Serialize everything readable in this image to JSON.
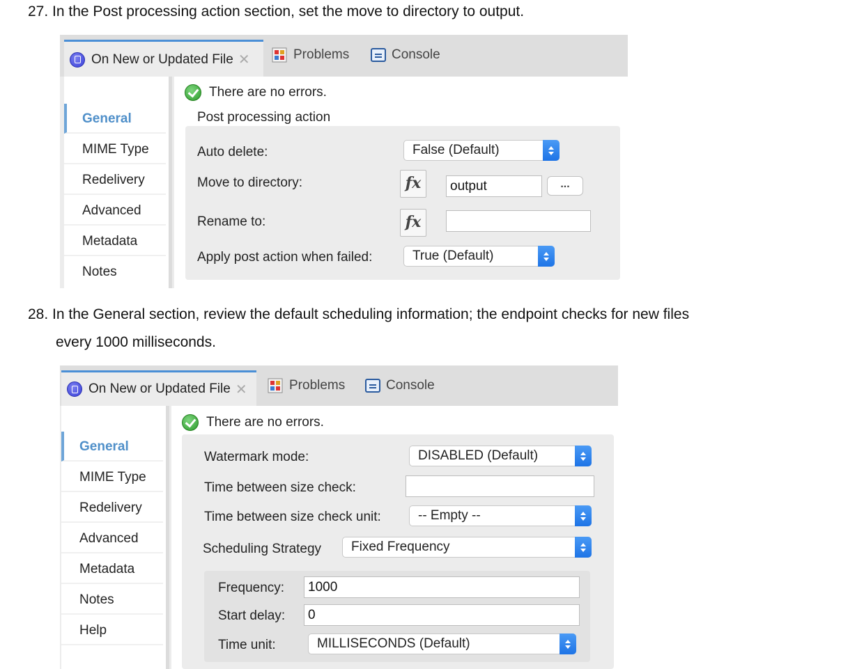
{
  "steps": [
    {
      "number": "27.",
      "text": "In the Post processing action section, set the move to directory to output."
    },
    {
      "number": "28.",
      "text_line1": "In the General section, review the default scheduling information; the endpoint checks for new files",
      "text_line2": "every 1000 milliseconds."
    }
  ],
  "tabs": {
    "active": "On New or Updated File",
    "problems": "Problems",
    "console": "Console"
  },
  "status": "There are no errors.",
  "sidebar1": [
    "General",
    "MIME Type",
    "Redelivery",
    "Advanced",
    "Metadata",
    "Notes"
  ],
  "sidebar2": [
    "General",
    "MIME Type",
    "Redelivery",
    "Advanced",
    "Metadata",
    "Notes",
    "Help"
  ],
  "panel1": {
    "section_title": "Post processing action",
    "auto_delete_label": "Auto delete:",
    "auto_delete_value": "False (Default)",
    "move_to_label": "Move to directory:",
    "move_to_value": "output",
    "rename_label": "Rename to:",
    "rename_value": "",
    "apply_label": "Apply post action when failed:",
    "apply_value": "True (Default)",
    "fx": "fx",
    "browse": "..."
  },
  "panel2": {
    "watermark_label": "Watermark mode:",
    "watermark_value": "DISABLED (Default)",
    "size_check_label": "Time between size check:",
    "size_check_value": "",
    "size_unit_label": "Time between size check unit:",
    "size_unit_value": "-- Empty --",
    "strategy_label": "Scheduling Strategy",
    "strategy_value": "Fixed Frequency",
    "frequency_label": "Frequency:",
    "frequency_value": "1000",
    "start_delay_label": "Start delay:",
    "start_delay_value": "0",
    "time_unit_label": "Time unit:",
    "time_unit_value": "MILLISECONDS (Default)"
  },
  "colors": {
    "accent": "#4a8fd6",
    "select_arrow": "#1e74e6",
    "active_sidebar": "#4f8fc9"
  }
}
